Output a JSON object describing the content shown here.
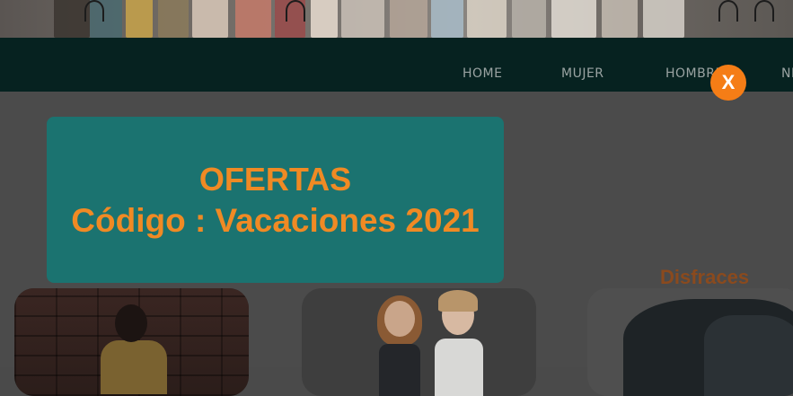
{
  "nav": {
    "items": [
      "HOME",
      "MUJER",
      "HOMBRE",
      "NIÑOS"
    ]
  },
  "section": {
    "title": "Disfraces"
  },
  "modal": {
    "title": "OFERTAS",
    "code_line": "Código : Vacaciones 2021",
    "close_label": "X"
  },
  "colors": {
    "modal_bg": "#1b7370",
    "modal_text": "#f08a24",
    "close_bg": "#f57d16",
    "navbar_bg": "#062220"
  },
  "icons": {
    "close": "close-icon"
  }
}
